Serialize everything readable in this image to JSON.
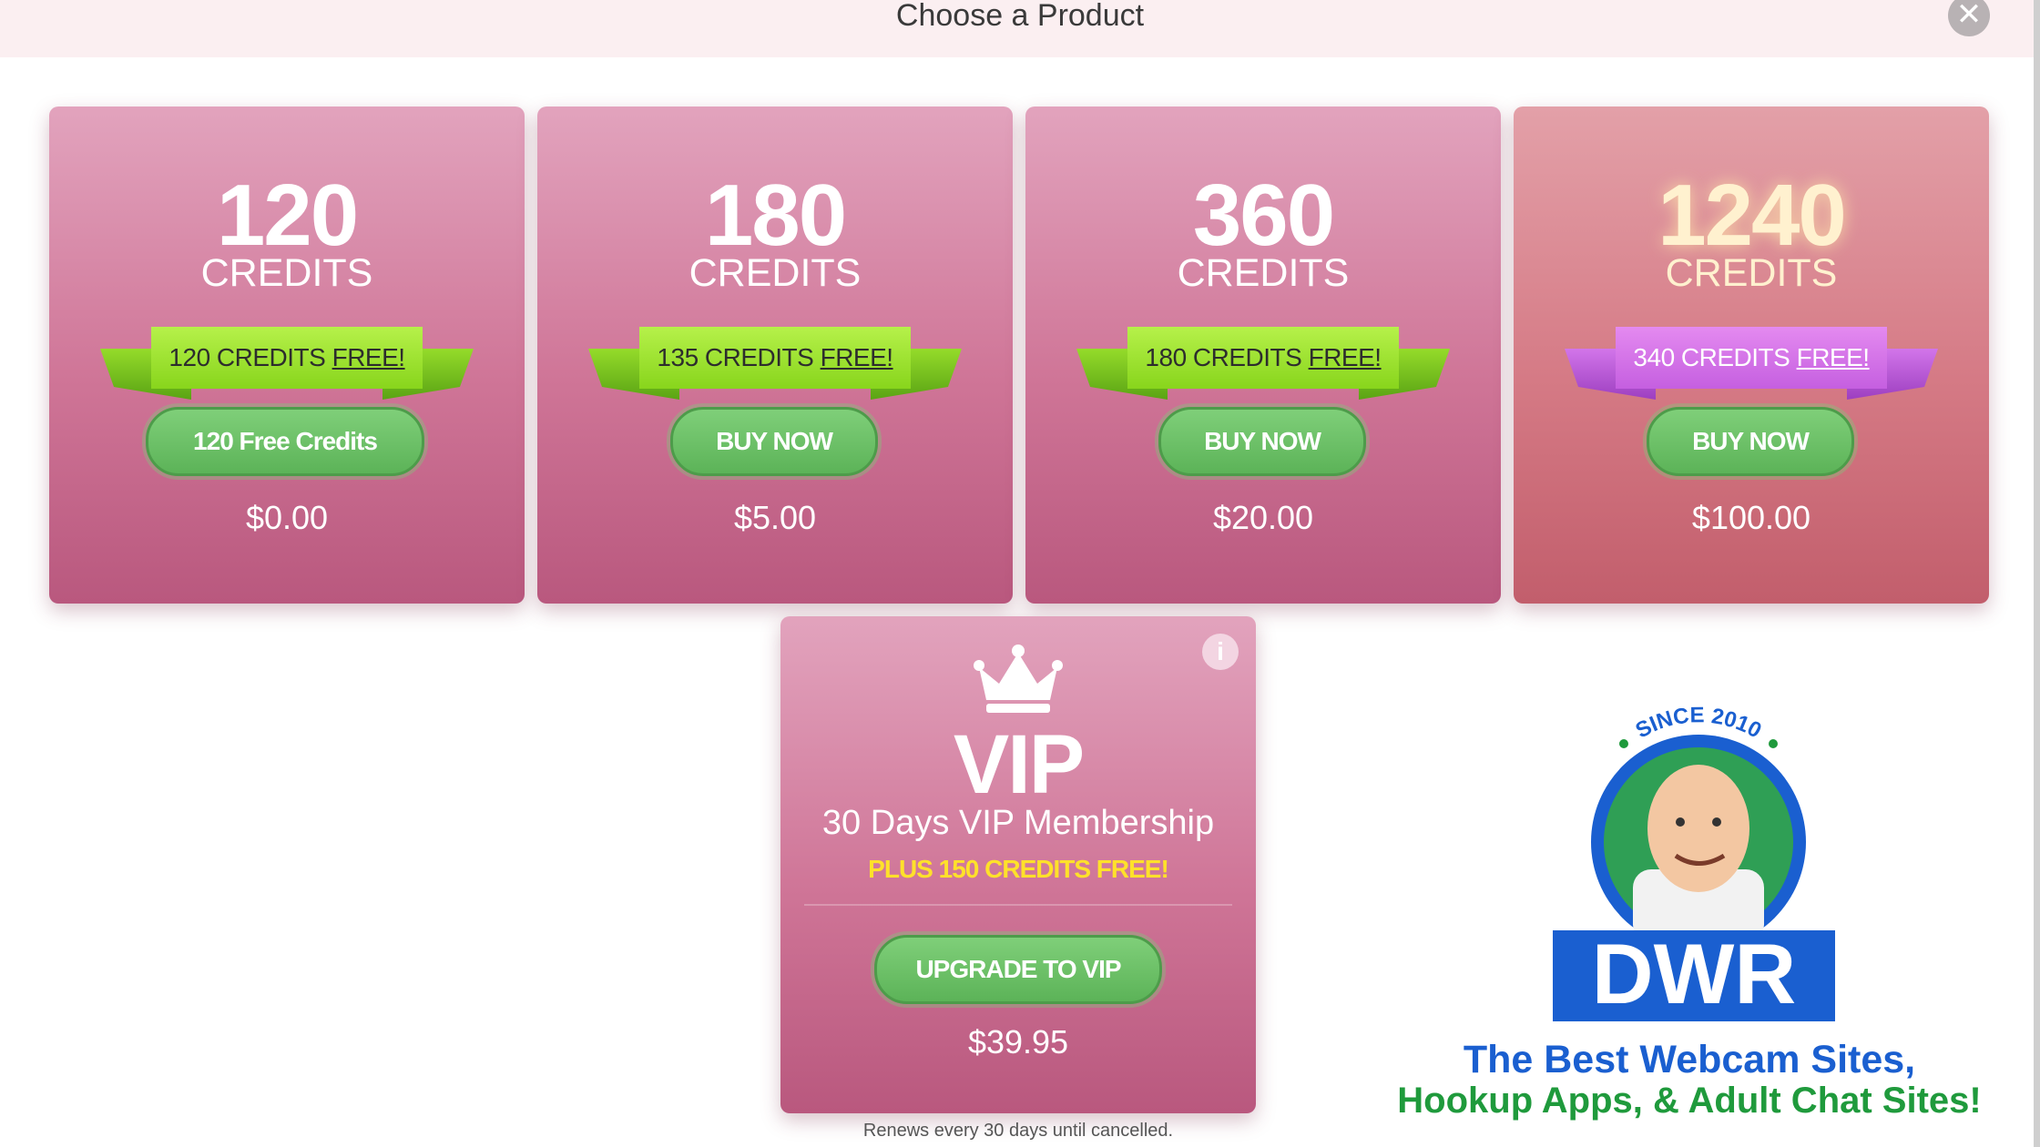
{
  "header": {
    "title": "Choose a Product",
    "close_label": "✕"
  },
  "products": [
    {
      "amount": "120",
      "unit": "CREDITS",
      "bonus_prefix": "120 CREDITS",
      "bonus_free": "FREE!",
      "button": "120 Free Credits",
      "price": "$0.00",
      "ribbon_color": "green"
    },
    {
      "amount": "180",
      "unit": "CREDITS",
      "bonus_prefix": "135 CREDITS",
      "bonus_free": "FREE!",
      "button": "BUY NOW",
      "price": "$5.00",
      "ribbon_color": "green"
    },
    {
      "amount": "360",
      "unit": "CREDITS",
      "bonus_prefix": "180 CREDITS",
      "bonus_free": "FREE!",
      "button": "BUY NOW",
      "price": "$20.00",
      "ribbon_color": "green"
    },
    {
      "amount": "1240",
      "unit": "CREDITS",
      "bonus_prefix": "340 CREDITS",
      "bonus_free": "FREE!",
      "button": "BUY NOW",
      "price": "$100.00",
      "ribbon_color": "purple"
    }
  ],
  "vip": {
    "info_label": "i",
    "title": "VIP",
    "subtitle": "30 Days VIP Membership",
    "bonus": "PLUS 150 CREDITS FREE!",
    "button": "UPGRADE TO VIP",
    "price": "$39.95",
    "renew_note": "Renews every 30 days until cancelled."
  },
  "logo": {
    "since": "SINCE 2010",
    "name": "DWR",
    "tagline_line1": "The Best Webcam Sites,",
    "tagline_line2": "Hookup Apps, & Adult Chat Sites!"
  },
  "colors": {
    "card_pink": "#cf7597",
    "card_gold": "#d57a85",
    "button_green": "#5cb358",
    "ribbon_green": "#88d51c",
    "ribbon_purple": "#c55fe0",
    "vip_bonus_yellow": "#ffe12a",
    "logo_blue": "#1a5fd0",
    "logo_green": "#1f9a3c"
  }
}
